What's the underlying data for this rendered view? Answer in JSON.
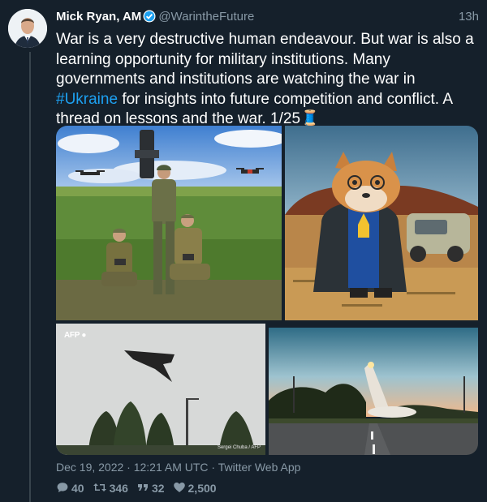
{
  "tweet": {
    "author_name": "Mick Ryan, AM",
    "handle": "@WarintheFuture",
    "relative_time": "13h",
    "text_before_hashtag": "War is a very destructive human endeavour. But war is also a learning opportunity for military institutions. Many governments and institutions are watching the war in ",
    "hashtag": "#Ukraine",
    "text_after_hashtag": " for insights into future competition and conflict. A thread on lessons and the war. 1/25",
    "thread_emoji": "🧵",
    "verified_icon": "verified-badge-icon",
    "images": [
      {
        "icon": "photo-soldiers-drones"
      },
      {
        "icon": "illustration-dog-in-suit"
      },
      {
        "icon": "photo-drone-over-trees",
        "watermark": "AFP",
        "credit": "Sergei Chuba / AFP"
      },
      {
        "icon": "photo-rocket-launch-road"
      }
    ],
    "meta": "Dec 19, 2022 · 12:21 AM UTC · Twitter Web App",
    "stats": {
      "replies": "40",
      "retweets": "346",
      "quotes": "32",
      "likes": "2,500"
    }
  },
  "colors": {
    "background": "#15202b",
    "text": "#ffffff",
    "muted": "#8899a6",
    "link": "#1da1f2"
  }
}
